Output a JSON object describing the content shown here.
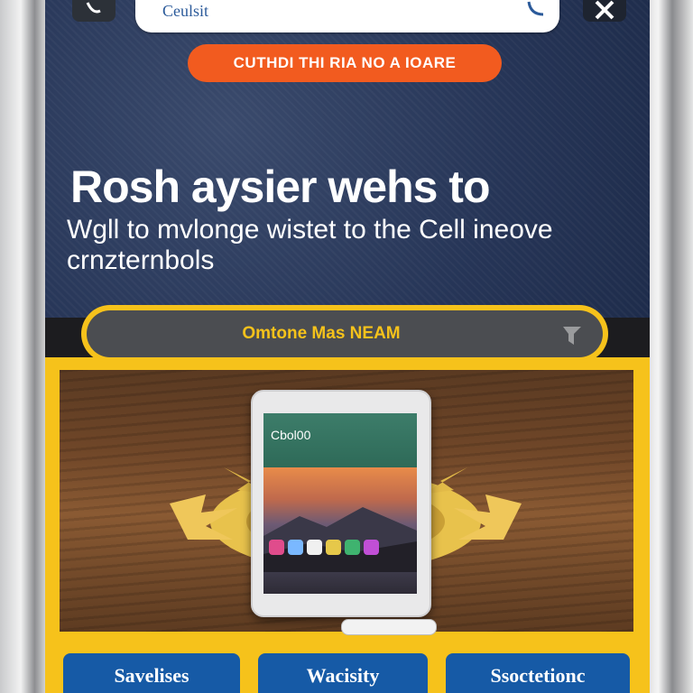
{
  "search": {
    "text": "Ceulsit"
  },
  "cta": {
    "label": "CUTHDI THI RIA NO A IOARE"
  },
  "hero": {
    "title": "Rosh aysier wehs to",
    "subtitle": "Wgll to mvlonge wistet to the Cell ineove crnzternbols"
  },
  "banner": {
    "label": "Omtone Mas NEAM"
  },
  "device": {
    "screen_title": "Cbol00"
  },
  "tabs": [
    {
      "label": "Savelises"
    },
    {
      "label": "Wacisity"
    },
    {
      "label": "Ssoctetionc"
    }
  ],
  "colors": {
    "navy": "#2b3a5a",
    "orange": "#f25b1f",
    "yellow": "#f6c21b",
    "blue": "#165aa6"
  },
  "icons": [
    "back-icon",
    "phone-icon",
    "close-icon",
    "banner-icon"
  ]
}
